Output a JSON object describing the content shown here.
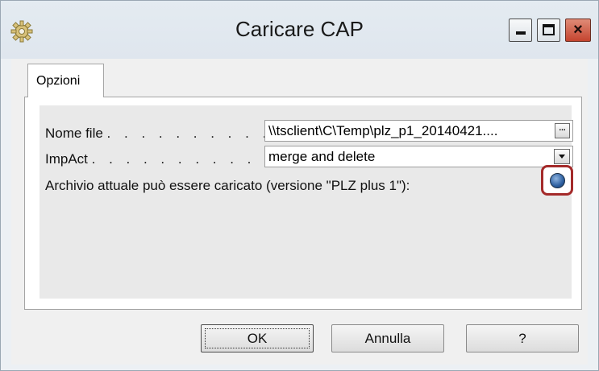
{
  "window": {
    "title": "Caricare CAP",
    "icon": "gear-icon",
    "controls": {
      "minimize": "minimize-icon",
      "maximize": "maximize-icon",
      "close": "×"
    }
  },
  "tabs": [
    {
      "label": "Opzioni",
      "active": true
    }
  ],
  "form": {
    "file_label": "Nome file",
    "file_dots": ". . . . . . . . . .",
    "file_value": "\\\\tsclient\\C\\Temp\\plz_p1_20140421....",
    "browse_label": "...",
    "impact_label": "ImpAct",
    "impact_dots": ". . . . . . . . . . .",
    "impact_value": "merge and delete",
    "status_text": "Archivio attuale può essere caricato (versione \"PLZ plus 1\"):",
    "status_icon": "status-led-icon",
    "status_color": "#2d5f9f",
    "highlight_color": "#a42a2a"
  },
  "buttons": {
    "ok": "OK",
    "cancel": "Annulla",
    "help": "?"
  }
}
